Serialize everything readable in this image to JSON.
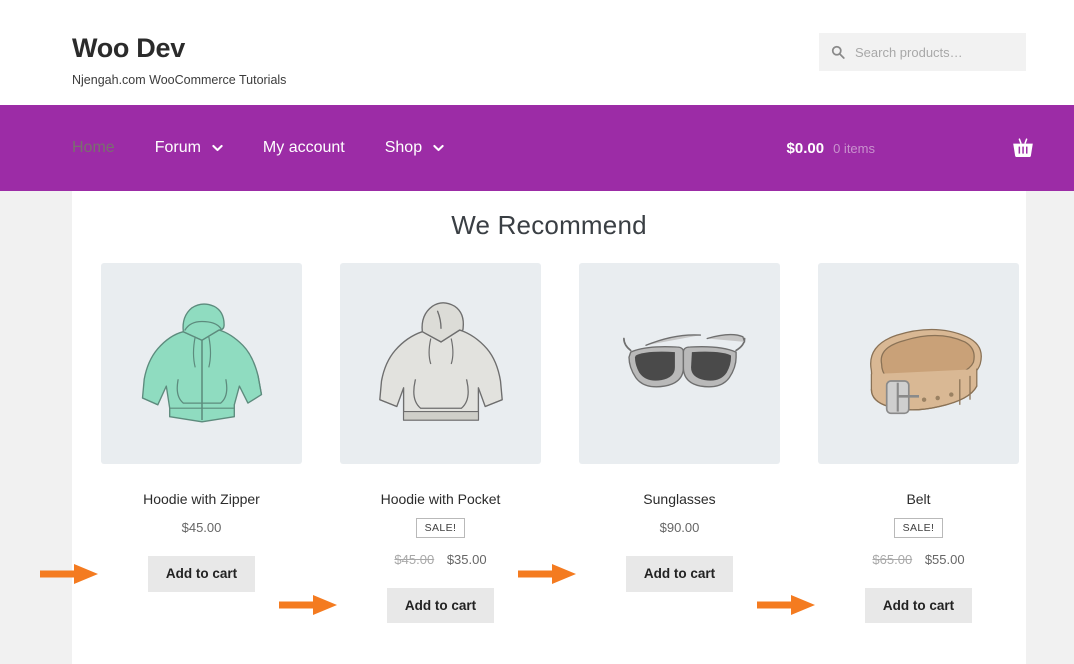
{
  "header": {
    "site_title": "Woo Dev",
    "site_description": "Njengah.com WooCommerce Tutorials",
    "search": {
      "placeholder": "Search products…",
      "value": "",
      "icon": "search-icon"
    }
  },
  "nav": {
    "accent_color": "#9C2CA6",
    "items": [
      {
        "label": "Home",
        "active": true,
        "has_dropdown": false
      },
      {
        "label": "Forum",
        "active": false,
        "has_dropdown": true
      },
      {
        "label": "My account",
        "active": false,
        "has_dropdown": false
      },
      {
        "label": "Shop",
        "active": false,
        "has_dropdown": true
      }
    ],
    "cart": {
      "amount": "$0.00",
      "items": "0 items",
      "icon": "shopping-basket-icon"
    }
  },
  "main": {
    "section_title": "We Recommend",
    "arrow_color": "#F47B20",
    "products": [
      {
        "name": "Hoodie with Zipper",
        "image": "zip-hoodie-mint",
        "on_sale": false,
        "sale_label": "",
        "price": "$45.00",
        "old_price": "",
        "button_label": "Add to cart"
      },
      {
        "name": "Hoodie with Pocket",
        "image": "pullover-hoodie-gray",
        "on_sale": true,
        "sale_label": "SALE!",
        "price": "$35.00",
        "old_price": "$45.00",
        "button_label": "Add to cart"
      },
      {
        "name": "Sunglasses",
        "image": "sunglasses-gray",
        "on_sale": false,
        "sale_label": "",
        "price": "$90.00",
        "old_price": "",
        "button_label": "Add to cart"
      },
      {
        "name": "Belt",
        "image": "leather-belt-tan",
        "on_sale": true,
        "sale_label": "SALE!",
        "price": "$55.00",
        "old_price": "$65.00",
        "button_label": "Add to cart"
      }
    ]
  }
}
